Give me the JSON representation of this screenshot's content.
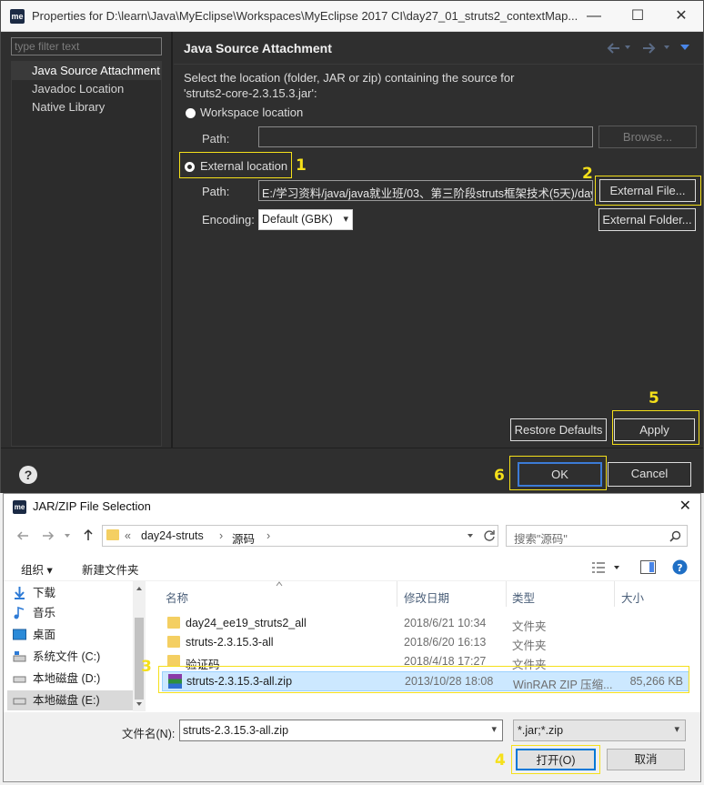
{
  "properties": {
    "title": "Properties for D:\\learn\\Java\\MyEclipse\\Workspaces\\MyEclipse 2017 CI\\day27_01_struts2_contextMap...",
    "app_icon": "me",
    "window_controls": {
      "minimize": "—",
      "maximize": "☐",
      "close": "✕"
    },
    "filter_placeholder": "type filter text",
    "nav_items": [
      "Java Source Attachment",
      "Javadoc Location",
      "Native Library"
    ],
    "page_title": "Java Source Attachment",
    "description_line1": "Select the location (folder, JAR or zip) containing the source for",
    "description_line2": "'struts2-core-2.3.15.3.jar':",
    "workspace_option": "Workspace location",
    "workspace_path_label": "Path:",
    "browse_label": "Browse...",
    "external_option": "External location",
    "external_path_label": "Path:",
    "external_path_value": "E:/学习资料/java/java就业班/03、第三阶段struts框架技术(5天)/day",
    "external_file_label": "External File...",
    "encoding_label": "Encoding:",
    "encoding_value": "Default (GBK)",
    "external_folder_label": "External Folder...",
    "restore_defaults_label": "Restore Defaults",
    "apply_label": "Apply",
    "help_glyph": "?",
    "ok_label": "OK",
    "cancel_label": "Cancel"
  },
  "annotations": {
    "n1": "1",
    "n2": "2",
    "n3": "3",
    "n4": "4",
    "n5": "5",
    "n6": "6",
    "color": "#f5e01a"
  },
  "dialog": {
    "title": "JAR/ZIP File Selection",
    "close_glyph": "✕",
    "breadcrumb": {
      "prefix": "«",
      "part1": "day24-struts",
      "sep": "›",
      "part2": "源码"
    },
    "search_placeholder": "搜索\"源码\"",
    "organize_label": "组织 ▾",
    "new_folder_label": "新建文件夹",
    "sidebar": [
      "下载",
      "音乐",
      "桌面",
      "系统文件 (C:)",
      "本地磁盘 (D:)",
      "本地磁盘 (E:)"
    ],
    "columns": {
      "name": "名称",
      "date": "修改日期",
      "type": "类型",
      "size": "大小"
    },
    "files": [
      {
        "name": "day24_ee19_struts2_all",
        "date": "2018/6/21 10:34",
        "type": "文件夹",
        "size": ""
      },
      {
        "name": "struts-2.3.15.3-all",
        "date": "2018/6/20 16:13",
        "type": "文件夹",
        "size": ""
      },
      {
        "name": "验证码",
        "date": "2018/4/18 17:27",
        "type": "文件夹",
        "size": ""
      },
      {
        "name": "struts-2.3.15.3-all.zip",
        "date": "2013/10/28 18:08",
        "type": "WinRAR ZIP 压缩...",
        "size": "85,266 KB"
      }
    ],
    "filename_label": "文件名(N):",
    "filename_value": "struts-2.3.15.3-all.zip",
    "filetype_value": "*.jar;*.zip",
    "open_label": "打开(O)",
    "cancel_label": "取消"
  }
}
